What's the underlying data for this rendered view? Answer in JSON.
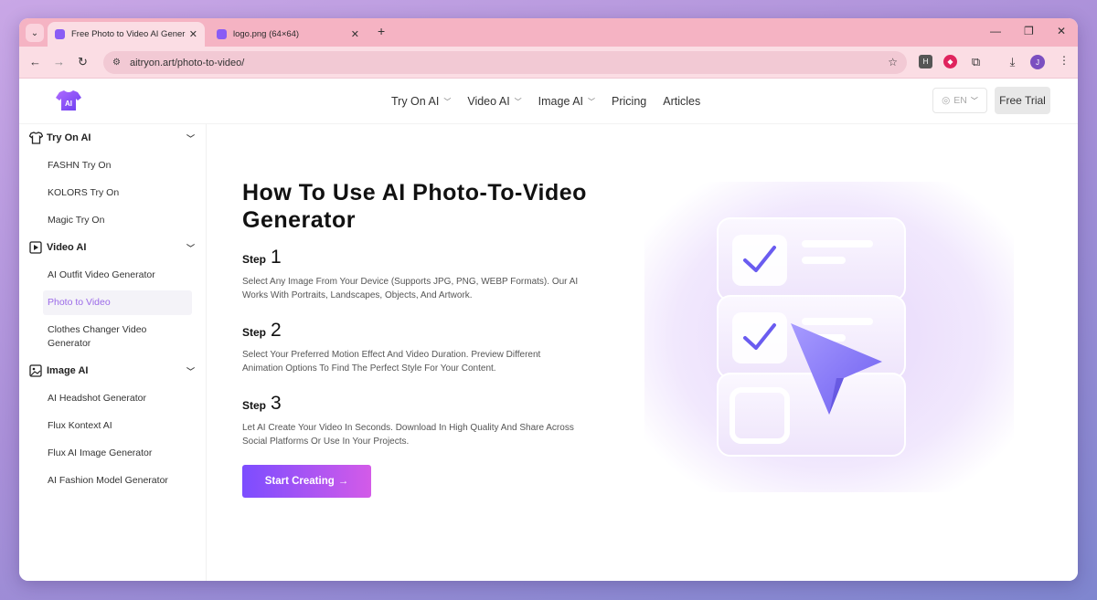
{
  "browser": {
    "tabs": [
      {
        "title": "Free Photo to Video AI Generat",
        "active": true
      },
      {
        "title": "logo.png (64×64)",
        "active": false
      }
    ],
    "url": "aitryon.art/photo-to-video/",
    "avatar_letter": "J",
    "ext_h_label": "H"
  },
  "header": {
    "logo_text": "AI",
    "nav": [
      "Try On AI",
      "Video AI",
      "Image AI",
      "Pricing",
      "Articles"
    ],
    "lang": "EN",
    "free_trial": "Free Trial"
  },
  "sidebar": {
    "sections": [
      {
        "label": "Try On AI",
        "icon": "shirt-icon",
        "items": [
          "FASHN Try On",
          "KOLORS Try On",
          "Magic Try On"
        ]
      },
      {
        "label": "Video AI",
        "icon": "play-icon",
        "items": [
          "AI Outfit Video Generator",
          "Photo to Video",
          "Clothes Changer Video Generator"
        ]
      },
      {
        "label": "Image AI",
        "icon": "image-icon",
        "items": [
          "AI Headshot Generator",
          "Flux Kontext AI",
          "Flux AI Image Generator",
          "AI Fashion Model Generator"
        ]
      }
    ],
    "active_item": "Photo to Video"
  },
  "main": {
    "title": "How To Use AI Photo-To-Video Generator",
    "step_word": "Step",
    "steps": [
      {
        "num": "1",
        "desc": "Select Any Image From Your Device (Supports JPG, PNG, WEBP Formats). Our AI Works With Portraits, Landscapes, Objects, And Artwork."
      },
      {
        "num": "2",
        "desc": "Select Your Preferred Motion Effect And Video Duration. Preview Different Animation Options To Find The Perfect Style For Your Content."
      },
      {
        "num": "3",
        "desc": "Let AI Create Your Video In Seconds. Download In High Quality And Share Across Social Platforms Or Use In Your Projects."
      }
    ],
    "cta": "Start Creating",
    "cta_arrow": "→"
  },
  "colors": {
    "accent": "#9b6ae8",
    "cta_start": "#7c4dff",
    "cta_end": "#d35be8",
    "tab_strip": "#f5b3c3"
  }
}
